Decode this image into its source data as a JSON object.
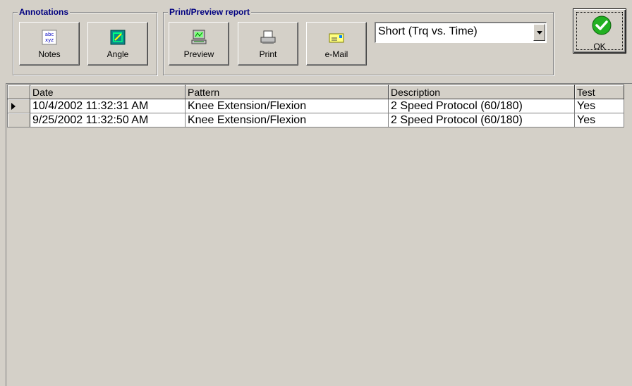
{
  "annotations": {
    "title": "Annotations",
    "notes_label": "Notes",
    "angle_label": "Angle"
  },
  "print_preview": {
    "title": "Print/Preview report",
    "preview_label": "Preview",
    "print_label": "Print",
    "email_label": "e-Mail",
    "report_select": "Short (Trq vs. Time)"
  },
  "ok_label": "OK",
  "table": {
    "columns": [
      "Date",
      "Pattern",
      "Description",
      "Test"
    ],
    "rows": [
      {
        "date": "10/4/2002 11:32:31 AM",
        "pattern": "Knee Extension/Flexion",
        "description": "2 Speed Protocol (60/180)",
        "test": "Yes",
        "current": true
      },
      {
        "date": "9/25/2002 11:32:50 AM",
        "pattern": "Knee Extension/Flexion",
        "description": "2 Speed Protocol (60/180)",
        "test": "Yes",
        "current": false
      }
    ]
  },
  "colors": {
    "face": "#d4d0c8",
    "group_title": "#000080",
    "ok_green": "#22b022"
  },
  "icons": [
    "abc-xyz-icon",
    "angle-icon",
    "preview-icon",
    "printer-icon",
    "email-icon",
    "check-icon",
    "row-indicator-icon",
    "chevron-down-icon"
  ]
}
